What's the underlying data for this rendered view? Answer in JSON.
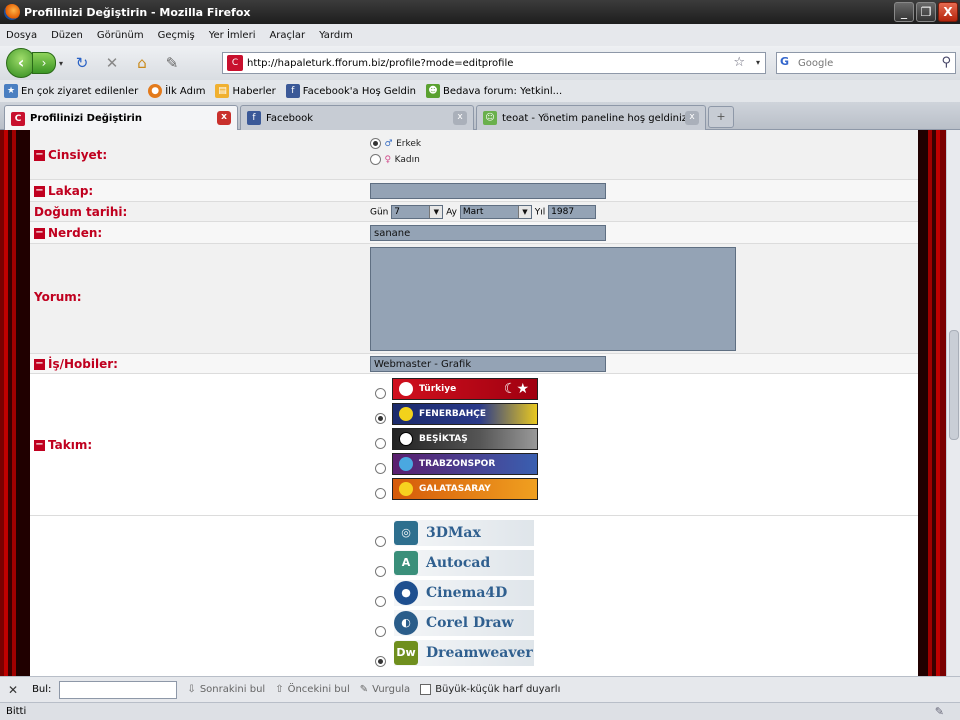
{
  "window": {
    "title": "Profilinizi Değiştirin - Mozilla Firefox",
    "min": "_",
    "max": "❐",
    "close": "X"
  },
  "menu": [
    "Dosya",
    "Düzen",
    "Görünüm",
    "Geçmiş",
    "Yer İmleri",
    "Araçlar",
    "Yardım"
  ],
  "nav": {
    "url": "http://hapaleturk.fforum.biz/profile?mode=editprofile",
    "search_engine": "G",
    "search_placeholder": "Google",
    "back": "‹",
    "forward": "›",
    "dropdown": "▾",
    "reload": "↻",
    "stop": "✕",
    "home": "⌂",
    "addons": "✎"
  },
  "bookmarks": [
    {
      "label": "En çok ziyaret edilenler",
      "color": "#4a7fc1",
      "glyph": "★"
    },
    {
      "label": "İlk Adım",
      "color": "#e37a1b",
      "glyph": "●"
    },
    {
      "label": "Haberler",
      "color": "#f0b030",
      "glyph": "▤"
    },
    {
      "label": "Facebook'a Hoş Geldin",
      "color": "#3b5998",
      "glyph": "f"
    },
    {
      "label": "Bedava forum: Yetkinl...",
      "color": "#5aa130",
      "glyph": "☻"
    }
  ],
  "tabs": [
    {
      "label": "Profilinizi Değiştirin",
      "active": true,
      "icon_color": "#c8102e",
      "glyph": "C"
    },
    {
      "label": "Facebook",
      "active": false,
      "icon_color": "#3b5998",
      "glyph": "f"
    },
    {
      "label": "teoat - Yönetim paneline hoş geldiniz",
      "active": false,
      "icon_color": "#6ab04c",
      "glyph": "☺"
    }
  ],
  "tab_close": "x",
  "newtab": "+",
  "form": {
    "gender": {
      "label": "Cinsiyet:",
      "options": [
        {
          "label": "Erkek",
          "symbol": "♂",
          "selected": true
        },
        {
          "label": "Kadın",
          "symbol": "♀",
          "selected": false
        }
      ]
    },
    "nickname": {
      "label": "Lakap:",
      "value": ""
    },
    "birthdate": {
      "label": "Doğum tarihi:",
      "day_label": "Gün",
      "day": "7",
      "month_label": "Ay",
      "month": "Mart",
      "year_label": "Yıl",
      "year": "1987"
    },
    "location": {
      "label": "Nerden:",
      "value": "sanane"
    },
    "comment": {
      "label": "Yorum:",
      "value": ""
    },
    "hobbies": {
      "label": "İş/Hobiler:",
      "value": "Webmaster - Grafik"
    },
    "team": {
      "label": "Takım:",
      "options": [
        {
          "name": "Türkiye",
          "selected": false,
          "color": "#d0101e"
        },
        {
          "name": "FENERBAHÇE",
          "selected": true,
          "color": "#1b2a6b"
        },
        {
          "name": "BEŞİKTAŞ",
          "selected": false,
          "color": "#333333"
        },
        {
          "name": "TRABZONSPOR",
          "selected": false,
          "color": "#5a1e6e"
        },
        {
          "name": "GALATASARAY",
          "selected": false,
          "color": "#d55a0a"
        }
      ]
    },
    "software": {
      "options": [
        {
          "name": "3DMax",
          "selected": false,
          "logo": "◎",
          "color": "#2e6f8e"
        },
        {
          "name": "Autocad",
          "selected": false,
          "logo": "A",
          "color": "#3a8f7a"
        },
        {
          "name": "Cinema4D",
          "selected": false,
          "logo": "●",
          "color": "#1e4f8f"
        },
        {
          "name": "Corel Draw",
          "selected": false,
          "logo": "◐",
          "color": "#2b5d8a"
        },
        {
          "name": "Dreamweaver",
          "selected": true,
          "logo": "Dw",
          "color": "#6f8f1e"
        }
      ]
    }
  },
  "findbar": {
    "close": "✕",
    "label": "Bul:",
    "next": "Sonrakini bul",
    "prev": "Öncekini bul",
    "highlight": "Vurgula",
    "match_case": "Büyük-küçük harf duyarlı"
  },
  "status": {
    "text": "Bitti"
  }
}
